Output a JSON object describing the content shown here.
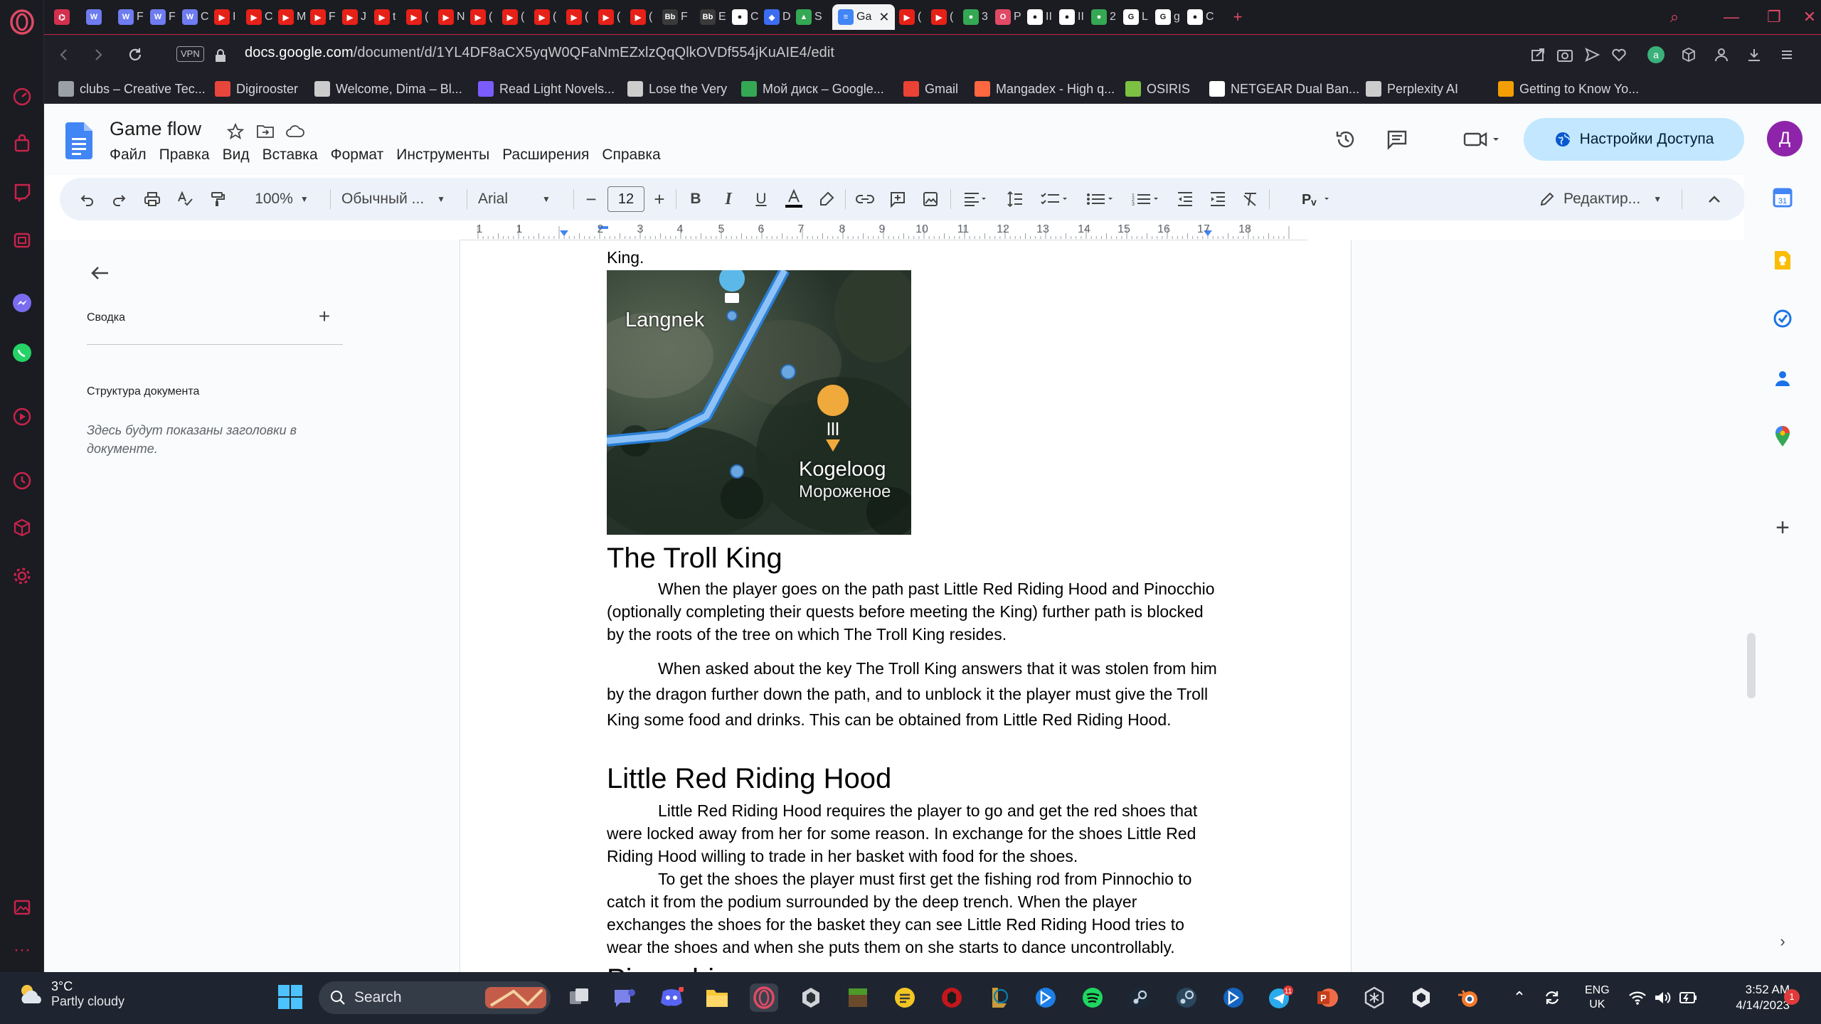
{
  "browser": {
    "tabs": [
      {
        "title": "",
        "favicon": "opera-gx-icon",
        "color": "#d3304e"
      },
      {
        "title": "",
        "favicon": "w-icon",
        "color": "#6e7cf0"
      },
      {
        "title": "F",
        "favicon": "w-icon",
        "color": "#6e7cf0"
      },
      {
        "title": "F",
        "favicon": "w-icon",
        "color": "#6e7cf0"
      },
      {
        "title": "C",
        "favicon": "w-icon",
        "color": "#6e7cf0"
      },
      {
        "title": "I",
        "favicon": "youtube-icon",
        "color": "#e62117"
      },
      {
        "title": "C",
        "favicon": "youtube-icon",
        "color": "#e62117"
      },
      {
        "title": "M",
        "favicon": "youtube-icon",
        "color": "#e62117"
      },
      {
        "title": "F",
        "favicon": "youtube-icon",
        "color": "#e62117"
      },
      {
        "title": "J",
        "favicon": "youtube-icon",
        "color": "#e62117"
      },
      {
        "title": "t",
        "favicon": "youtube-icon",
        "color": "#e62117"
      },
      {
        "title": "(",
        "favicon": "youtube-icon",
        "color": "#e62117"
      },
      {
        "title": "N",
        "favicon": "youtube-icon",
        "color": "#e62117"
      },
      {
        "title": "(",
        "favicon": "youtube-icon",
        "color": "#e62117"
      },
      {
        "title": "(",
        "favicon": "youtube-icon",
        "color": "#e62117"
      },
      {
        "title": "(",
        "favicon": "youtube-icon",
        "color": "#e62117"
      },
      {
        "title": "(",
        "favicon": "youtube-icon",
        "color": "#e62117"
      },
      {
        "title": "(",
        "favicon": "youtube-icon",
        "color": "#e62117"
      },
      {
        "title": "(",
        "favicon": "youtube-icon",
        "color": "#e62117"
      },
      {
        "title": "F",
        "favicon": "bb-icon",
        "color": "#3a3a3a"
      },
      {
        "title": "E",
        "favicon": "bb-icon",
        "color": "#3a3a3a"
      },
      {
        "title": "C",
        "favicon": "circle-icon",
        "color": "#ffffff"
      },
      {
        "title": "D",
        "favicon": "shield-icon",
        "color": "#3c6df0"
      },
      {
        "title": "S",
        "favicon": "drive-icon",
        "color": "#34a853"
      }
    ],
    "active_tab": {
      "title": "Ga",
      "favicon": "docs-icon",
      "color": "#4285f4"
    },
    "tabs_after": [
      {
        "title": "(",
        "favicon": "youtube-icon",
        "color": "#e62117"
      },
      {
        "title": "(",
        "favicon": "youtube-icon",
        "color": "#e62117"
      },
      {
        "title": "3",
        "favicon": "maps-icon",
        "color": "#34a853"
      },
      {
        "title": "P",
        "favicon": "opera-icon",
        "color": "#e04a65"
      },
      {
        "title": "II",
        "favicon": "circle-icon",
        "color": "#ffffff"
      },
      {
        "title": "II",
        "favicon": "circle-icon",
        "color": "#ffffff"
      },
      {
        "title": "2",
        "favicon": "maps-icon",
        "color": "#34a853"
      },
      {
        "title": "L",
        "favicon": "g-icon",
        "color": "#ffffff"
      },
      {
        "title": "g",
        "favicon": "google-icon",
        "color": "#ffffff"
      },
      {
        "title": "C",
        "favicon": "github-icon",
        "color": "#ffffff"
      }
    ],
    "url_prefix": "docs.google.com",
    "url_rest": "/document/d/1YL4DF8aCX5yqW0QFaNmEZxlzQqQlkOVDf554jKuAIE4/edit",
    "vpn_label": "VPN",
    "bookmarks": [
      {
        "label": "clubs – Creative Tec...",
        "icon": "clubs-icon",
        "color": "#9aa0a6"
      },
      {
        "label": "Digirooster",
        "icon": "digirooster-icon",
        "color": "#e8453c"
      },
      {
        "label": "Welcome, Dima – Bl...",
        "icon": "bb-icon",
        "color": "#cccccc"
      },
      {
        "label": "Read Light Novels...",
        "icon": "novel-icon",
        "color": "#7b5cff"
      },
      {
        "label": "Lose the Very",
        "icon": "pen-icon",
        "color": "#cccccc"
      },
      {
        "label": "Мой диск – Google...",
        "icon": "drive-icon",
        "color": "#34a853"
      },
      {
        "label": "Gmail",
        "icon": "gmail-icon",
        "color": "#ea4335"
      },
      {
        "label": "Mangadex - High q...",
        "icon": "mangadex-icon",
        "color": "#ff6740"
      },
      {
        "label": "OSIRIS",
        "icon": "osiris-icon",
        "color": "#7cc142"
      },
      {
        "label": "NETGEAR Dual Ban...",
        "icon": "page-icon",
        "color": "#ffffff"
      },
      {
        "label": "Perplexity AI",
        "icon": "grid-icon",
        "color": "#cccccc"
      },
      {
        "label": "Getting to Know Yo...",
        "icon": "chevron-icon",
        "color": "#f29f05"
      }
    ]
  },
  "docs": {
    "title": "Game flow",
    "menu": [
      "Файл",
      "Правка",
      "Вид",
      "Вставка",
      "Формат",
      "Инструменты",
      "Расширения",
      "Справка"
    ],
    "share_label": "Настройки Доступа",
    "avatar_letter": "Д",
    "toolbar": {
      "zoom": "100%",
      "style": "Обычный ...",
      "font": "Arial",
      "font_size": "12",
      "mode": "Редактир..."
    },
    "ruler_numbers": [
      "2",
      "1",
      "1",
      "2",
      "3",
      "4",
      "5",
      "6",
      "7",
      "8",
      "9",
      "10",
      "11",
      "12",
      "13",
      "14",
      "15",
      "16",
      "17",
      "18"
    ],
    "outline": {
      "summary_label": "Сводка",
      "structure_label": "Структура документа",
      "hint": "Здесь будут показаны заголовки в документе."
    },
    "content": {
      "top_fragment": "King.",
      "map": {
        "label1": "Langnek",
        "label2": "Kogeloog",
        "label3": "Мороженое"
      },
      "sections": [
        {
          "heading": "The Troll King",
          "paragraphs": [
            "When the player goes on the path past Little Red Riding Hood and Pinocchio (optionally completing their quests before meeting the King) further path is blocked by the roots of the tree on which The Troll King resides.",
            "When asked about the key The Troll King answers that it was stolen from him by the dragon further down the path, and to unblock it the player must give the Troll King some food and drinks. This can be obtained from Little Red Riding Hood."
          ]
        },
        {
          "heading": "Little Red Riding Hood",
          "paragraphs": [
            "Little Red Riding Hood requires the player to go and get the red shoes that were locked away from her for some reason. In exchange for the shoes Little Red Riding Hood willing to trade in her basket with food for the shoes.",
            "To get the shoes the player must first get the fishing rod from Pinnochio to catch it from the podium surrounded by the deep trench. When the player exchanges the shoes for the basket they can see Little Red Riding Hood tries to wear the shoes and when she puts them on she starts to dance uncontrollably."
          ]
        },
        {
          "heading": "Pinocchio",
          "paragraphs": []
        }
      ]
    }
  },
  "taskbar": {
    "weather_temp": "3°C",
    "weather_cond": "Partly cloudy",
    "search_label": "Search",
    "lang_top": "ENG",
    "lang_bottom": "UK",
    "time": "3:52 AM",
    "date": "4/14/2023",
    "notifications": "1",
    "telegram_badge": "11"
  }
}
